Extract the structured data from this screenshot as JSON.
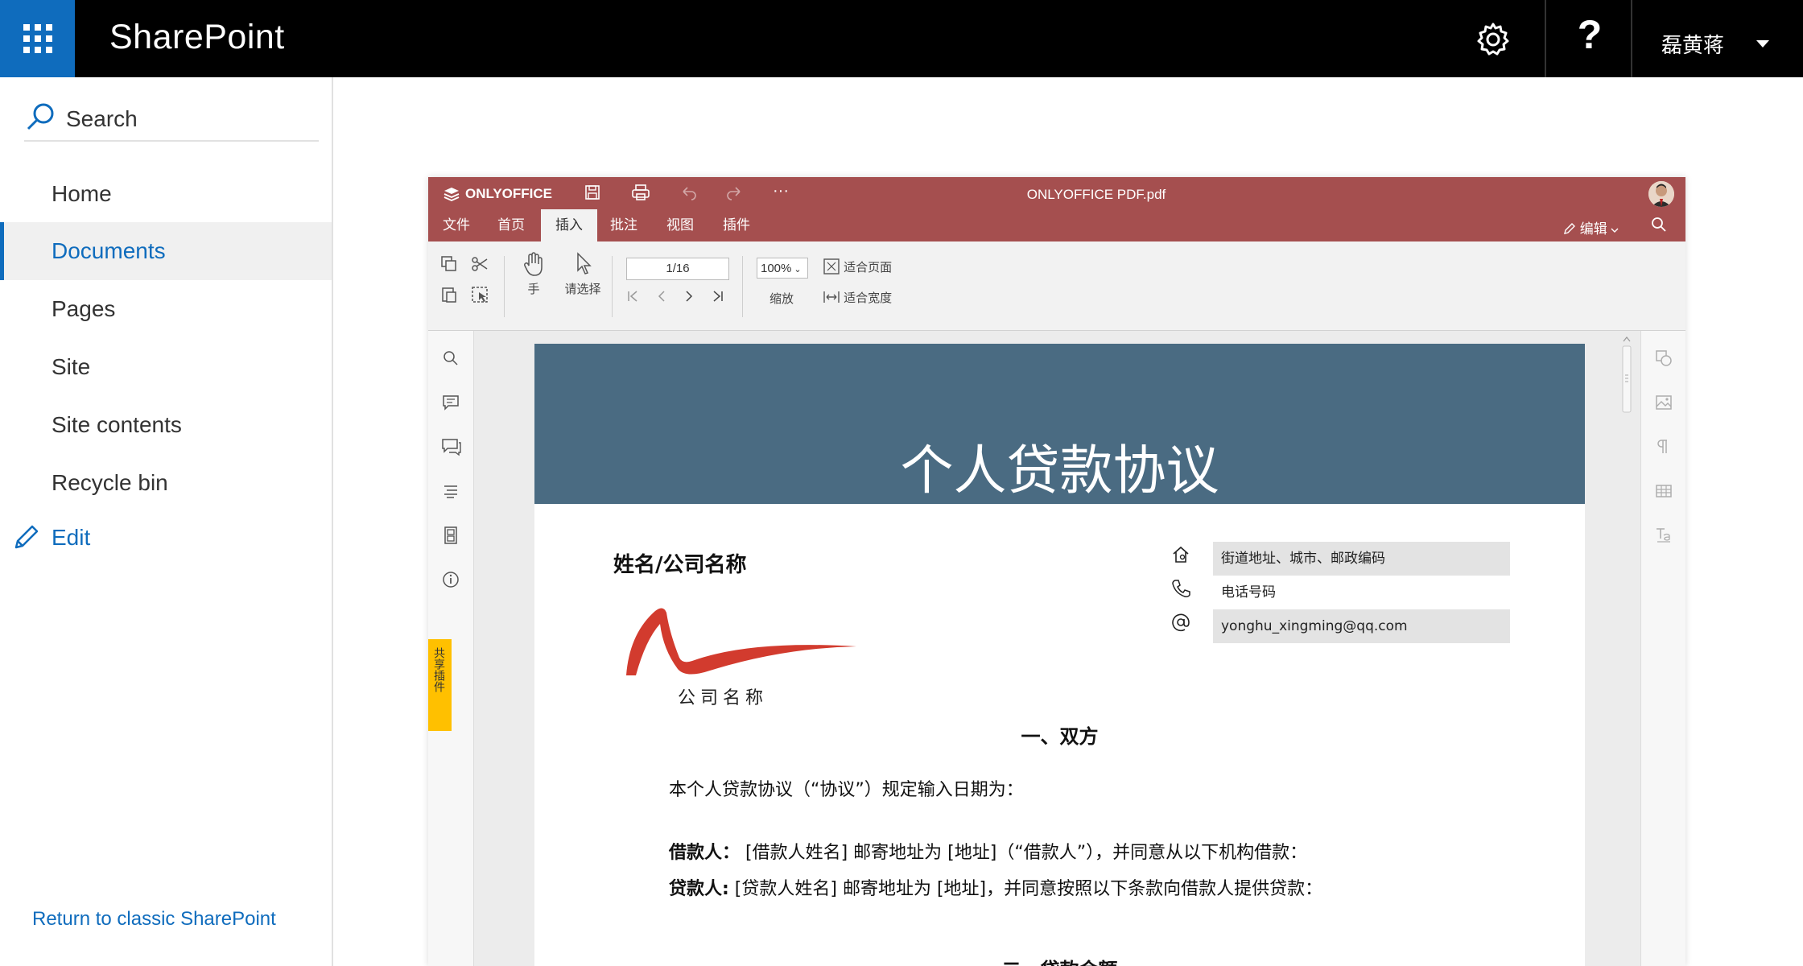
{
  "topbar": {
    "brand": "SharePoint",
    "user_name": "磊黄蒋",
    "help_glyph": "?",
    "icons": [
      "app-launcher-icon",
      "gear-icon",
      "help-icon",
      "chevron-down-icon"
    ]
  },
  "leftnav": {
    "search_label": "Search",
    "items": [
      {
        "label": "Home",
        "active": false
      },
      {
        "label": "Documents",
        "active": true
      },
      {
        "label": "Pages",
        "active": false
      },
      {
        "label": "Site",
        "active": false
      },
      {
        "label": "Site contents",
        "active": false
      },
      {
        "label": "Recycle bin",
        "active": false
      }
    ],
    "edit_label": "Edit",
    "return_link": "Return to classic SharePoint"
  },
  "editor": {
    "brand": "ONLYOFFICE",
    "file_title": "ONLYOFFICE PDF.pdf",
    "more_glyph": "···",
    "tabs": [
      {
        "label": "文件",
        "active": false
      },
      {
        "label": "首页",
        "active": false
      },
      {
        "label": "插入",
        "active": true
      },
      {
        "label": "批注",
        "active": false
      },
      {
        "label": "视图",
        "active": false
      },
      {
        "label": "插件",
        "active": false
      }
    ],
    "mode_label": "编辑",
    "toolbar": {
      "hand_label": "手",
      "select_label": "请选择",
      "page_value": "1/16",
      "zoom_value": "100%",
      "zoom_label": "缩放",
      "fit_page": "适合页面",
      "fit_width": "适合宽度"
    },
    "plugin_tab_label": "共享插件"
  },
  "document": {
    "title": "个人贷款协议",
    "name_company": "姓名/公司名称",
    "company_name": "公司名称",
    "address_field": "街道地址、城市、邮政编码",
    "phone_field": "电话号码",
    "email_field": "yonghu_xingming@qq.com",
    "section1": "一、双方",
    "para1": "本个人贷款协议（“协议”）规定输入日期为：",
    "borrower_label": "借款人：",
    "borrower_text": " [借款人姓名] 邮寄地址为 [地址]（“借款人”），并同意从以下机构借款：",
    "lender_label": "贷款人:",
    "lender_text": " [贷款人姓名] 邮寄地址为 [地址]，并同意按照以下条款向借款人提供贷款：",
    "section2": "二、贷款金额"
  },
  "colors": {
    "sharepoint_blue": "#0f6cbd",
    "onlyoffice_header": "#a54f4f",
    "banner": "#4a6b82",
    "plugin_tab": "#ffc000"
  }
}
